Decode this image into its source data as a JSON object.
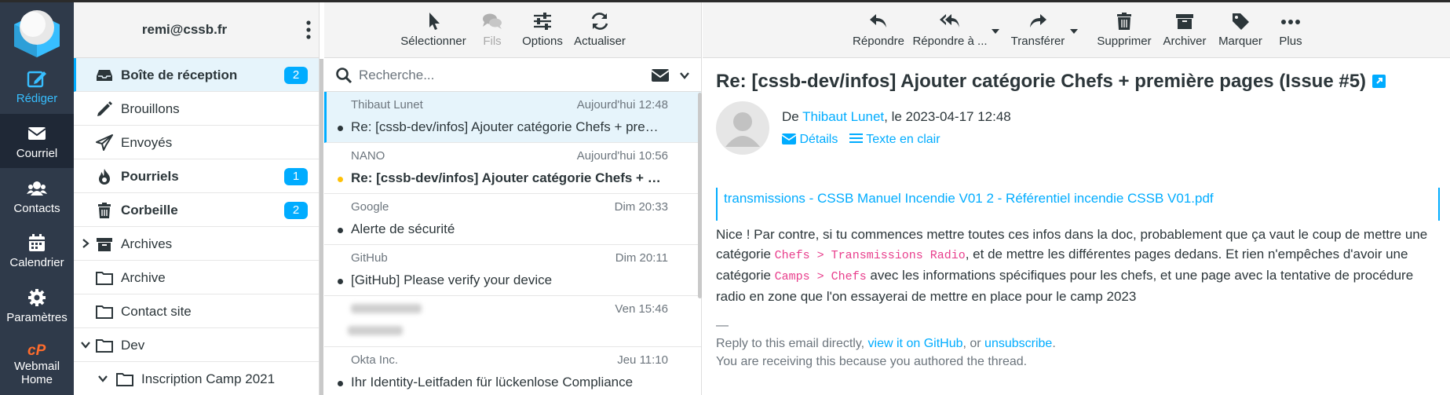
{
  "nav": {
    "compose": "Rédiger",
    "mail": "Courriel",
    "contacts": "Contacts",
    "calendar": "Calendrier",
    "settings": "Paramètres",
    "webmail_home_1": "Webmail",
    "webmail_home_2": "Home"
  },
  "account": {
    "email": "remi@cssb.fr"
  },
  "folders": {
    "inbox": {
      "label": "Boîte de réception",
      "count": "2"
    },
    "drafts": {
      "label": "Brouillons"
    },
    "sent": {
      "label": "Envoyés"
    },
    "spam": {
      "label": "Pourriels",
      "count": "1"
    },
    "trash": {
      "label": "Corbeille",
      "count": "2"
    },
    "archives": {
      "label": "Archives"
    },
    "archive": {
      "label": "Archive"
    },
    "contact_site": {
      "label": "Contact site"
    },
    "dev": {
      "label": "Dev"
    },
    "inscription": {
      "label": "Inscription Camp 2021"
    }
  },
  "list_toolbar": {
    "select": "Sélectionner",
    "threads": "Fils",
    "options": "Options",
    "refresh": "Actualiser"
  },
  "search": {
    "placeholder": "Recherche..."
  },
  "messages": [
    {
      "from": "Thibaut Lunet",
      "date": "Aujourd'hui 12:48",
      "subject": "Re: [cssb-dev/infos] Ajouter catégorie Chefs + première pages (Issue #5)"
    },
    {
      "from": "NANO",
      "date": "Aujourd'hui 10:56",
      "subject": "Re: [cssb-dev/infos] Ajouter catégorie Chefs + première pages (Issue #5)"
    },
    {
      "from": "Google",
      "date": "Dim 20:33",
      "subject": "Alerte de sécurité"
    },
    {
      "from": "GitHub",
      "date": "Dim 20:11",
      "subject": "[GitHub] Please verify your device"
    },
    {
      "from": "",
      "date": "Ven 15:46",
      "subject": ""
    },
    {
      "from": "Okta Inc.",
      "date": "Jeu 11:10",
      "subject": "Ihr Identity-Leitfaden für lückenlose Compliance"
    }
  ],
  "reader_toolbar": {
    "reply": "Répondre",
    "reply_all": "Répondre à ...",
    "forward": "Transférer",
    "delete": "Supprimer",
    "archive": "Archiver",
    "mark": "Marquer",
    "more": "Plus"
  },
  "email": {
    "subject": "Re: [cssb-dev/infos] Ajouter catégorie Chefs + première pages (Issue #5)",
    "from_prefix": "De ",
    "from_name": "Thibaut Lunet",
    "date_text": ", le 2023-04-17 12:48",
    "details": "Détails",
    "plain_text": "Texte en clair",
    "attachment": "transmissions - CSSB Manuel Incendie V01 2 - Référentiel incendie CSSB V01.pdf",
    "body_1": "Nice ! Par contre, si tu commences mettre toutes ces infos dans la doc, probablement que ça vaut le coup de mettre une catégorie ",
    "code_1": "Chefs > Transmissions Radio",
    "body_2": ", et de mettre les différentes pages dedans. Et rien n'empêches d'avoir une catégorie ",
    "code_2": "Camps > Chefs",
    "body_3": " avec les informations spécifiques pour les chefs, et une page avec la tentative de procédure radio en zone que l'on essayerai de mettre en place pour le camp 2023",
    "sig_dash": "—",
    "sig_1": "Reply to this email directly, ",
    "sig_link_1": "view it on GitHub",
    "sig_2": ", or ",
    "sig_link_2": "unsubscribe",
    "sig_3": ".",
    "sig_line_2": "You are receiving this because you authored the thread."
  },
  "colors": {
    "accent": "#00acff",
    "nav_bg": "#2f3a4a",
    "selected_bg": "#e6f4fb",
    "code": "#e83e8c"
  }
}
